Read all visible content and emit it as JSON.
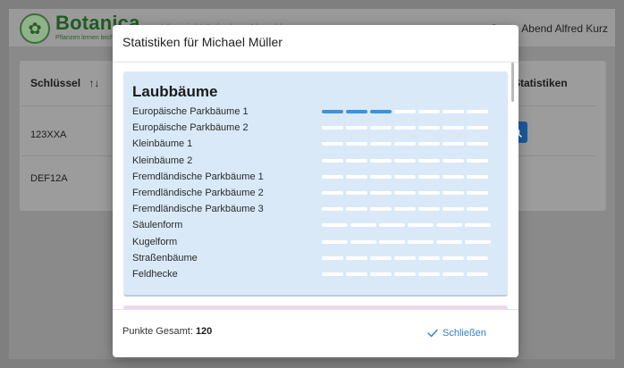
{
  "app": {
    "brand": "Botanica",
    "tagline": "Pflanzen lernen leicht gemacht",
    "nav_text": "Übersicht    Aufgaben    Abmelden",
    "greeting": "Guten Abend Alfred Kurz"
  },
  "table": {
    "columns": [
      "Schlüssel",
      "Statistiken"
    ],
    "sort_icon": "sort-icon",
    "rows": [
      "123XXA",
      "DEF12A"
    ],
    "search_icon": "search-icon"
  },
  "modal": {
    "title": "Statistiken für Michael Müller",
    "section": {
      "title": "Laubbäume",
      "items": [
        {
          "name": "Europäische Parkbäume 1",
          "segments": 7,
          "filled": 3
        },
        {
          "name": "Europäische Parkbäume 2",
          "segments": 7,
          "filled": 0
        },
        {
          "name": "Kleinbäume 1",
          "segments": 7,
          "filled": 0
        },
        {
          "name": "Kleinbäume 2",
          "segments": 7,
          "filled": 0
        },
        {
          "name": "Fremdländische Parkbäume 1",
          "segments": 7,
          "filled": 0
        },
        {
          "name": "Fremdländische Parkbäume 2",
          "segments": 7,
          "filled": 0
        },
        {
          "name": "Fremdländische Parkbäume 3",
          "segments": 7,
          "filled": 0
        },
        {
          "name": "Säulenform",
          "segments": 6,
          "filled": 0
        },
        {
          "name": "Kugelform",
          "segments": 6,
          "filled": 0
        },
        {
          "name": "Straßenbäume",
          "segments": 7,
          "filled": 0
        },
        {
          "name": "Feldhecke",
          "segments": 7,
          "filled": 0
        }
      ]
    },
    "footer": {
      "points_label": "Punkte Gesamt:",
      "points_value": "120",
      "close_label": "Schließen",
      "close_icon": "check-icon"
    }
  },
  "colors": {
    "accent": "#2c7fd1",
    "progress_filled": "#3e93d8",
    "section_bg": "#d9e9f8",
    "brand_green": "#1e5c21"
  }
}
